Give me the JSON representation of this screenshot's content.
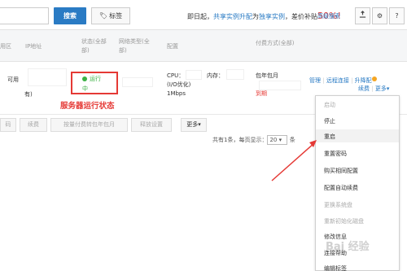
{
  "toolbar": {
    "search_label": "搜索",
    "tag_label": "标签",
    "tag_icon": "tag-icon",
    "promo_prefix": "即日起，",
    "promo_link1": "共享实例",
    "promo_link2": "升配",
    "promo_mid": "为",
    "promo_link3": "独享实例",
    "promo_suffix": "，差价补贴",
    "promo_pct": "50%!",
    "advanced_search": "高级搜索",
    "icons": [
      "export-icon",
      "gear-icon",
      "help-icon"
    ]
  },
  "table": {
    "headers": {
      "zone": "用区",
      "ip": "IP地址",
      "status": "状态(全部",
      "status2": "部)",
      "network": "网络类型(全",
      "network2": "部)",
      "config": "配置",
      "billing": "付费方式(全部)"
    },
    "row": {
      "zone": "可用",
      "ip_suffix": "有)",
      "status_line1": "运行",
      "status_line2": "中",
      "cpu": "CPU：",
      "io": "(I/O优化)",
      "bandwidth": "1Mbps",
      "memory": "内存：",
      "billing": "包年包月",
      "expiry": "到期",
      "action_manage": "管理",
      "action_remote": "远程连接",
      "action_upgrade": "升降配",
      "action_renew": "续费",
      "action_more": "更多▾"
    }
  },
  "annotation": "服务器运行状态",
  "action_bar": {
    "btn1": "码",
    "btn2": "续费",
    "btn3": "按量付费转包年包月",
    "btn4": "释放设置",
    "btn5": "更多▾"
  },
  "pager": {
    "total": "共有1条，每页显示：",
    "page_size": "20",
    "unit": "条"
  },
  "menu": {
    "items": [
      {
        "label": "启动",
        "enabled": false
      },
      {
        "label": "停止",
        "enabled": true
      },
      {
        "label": "重启",
        "enabled": true
      },
      {
        "label": "重置密码",
        "enabled": true
      },
      {
        "label": "购买相同配置",
        "enabled": true
      },
      {
        "label": "配置自动续费",
        "enabled": true
      },
      {
        "label": "更换系统盘",
        "enabled": false
      },
      {
        "label": "重新初始化磁盘",
        "enabled": false
      },
      {
        "label": "修改信息",
        "enabled": true
      },
      {
        "label": "连接帮助",
        "enabled": true
      },
      {
        "label": "编辑标签",
        "enabled": true
      }
    ]
  },
  "watermark": "Bai 经验",
  "colors": {
    "accent": "#2a7bc4",
    "annotation_red": "#e53935",
    "running_green": "#3bb143"
  }
}
